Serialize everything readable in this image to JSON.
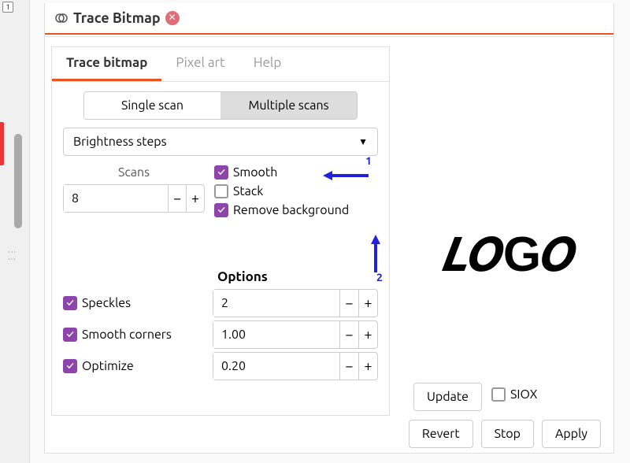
{
  "window": {
    "title": "Trace Bitmap"
  },
  "tabs": {
    "trace": "Trace bitmap",
    "pixel": "Pixel art",
    "help": "Help"
  },
  "scan_mode": {
    "single": "Single scan",
    "multiple": "Multiple scans"
  },
  "dropdown": {
    "selected": "Brightness steps"
  },
  "scans": {
    "label": "Scans",
    "value": "8"
  },
  "checks": {
    "smooth": "Smooth",
    "stack": "Stack",
    "remove_bg": "Remove background"
  },
  "annotations": {
    "a1": "1",
    "a2": "2"
  },
  "options": {
    "header": "Options",
    "speckles": {
      "label": "Speckles",
      "value": "2"
    },
    "smooth_corners": {
      "label": "Smooth corners",
      "value": "1.00"
    },
    "optimize": {
      "label": "Optimize",
      "value": "0.20"
    }
  },
  "preview": {
    "text": "LOGO"
  },
  "buttons": {
    "update": "Update",
    "siox": "SIOX",
    "revert": "Revert",
    "stop": "Stop",
    "apply": "Apply"
  }
}
